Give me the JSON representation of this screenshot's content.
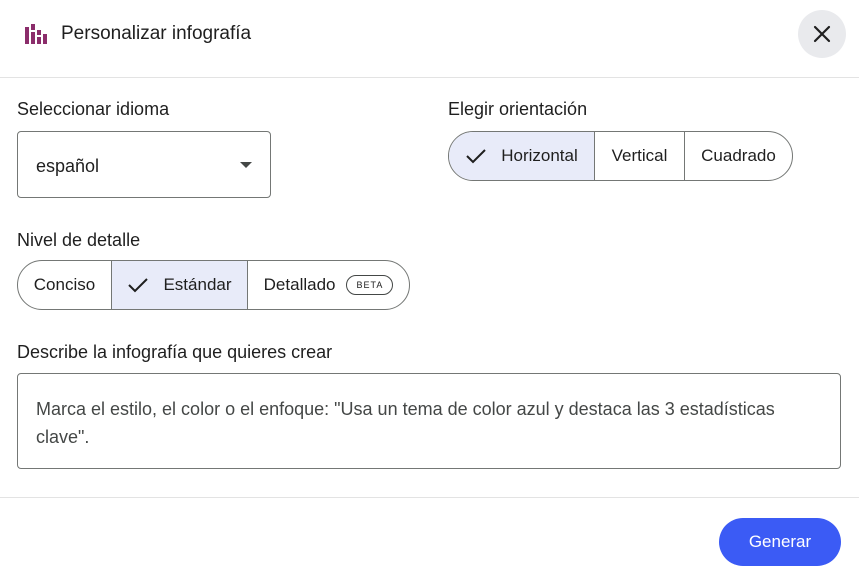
{
  "dialog": {
    "title": "Personalizar infografía",
    "title_icon": "infographic-icon",
    "close_icon": "close-icon"
  },
  "language": {
    "label": "Seleccionar idioma",
    "selected": "español",
    "caret_icon": "dropdown-caret-icon"
  },
  "orientation": {
    "label": "Elegir orientación",
    "options": [
      "Horizontal",
      "Vertical",
      "Cuadrado"
    ],
    "selected": "Horizontal"
  },
  "detail": {
    "label": "Nivel de detalle",
    "options": [
      "Conciso",
      "Estándar",
      "Detallado"
    ],
    "selected": "Estándar",
    "beta_badge": "BETA"
  },
  "description": {
    "label": "Describe la infografía que quieres crear",
    "placeholder": "Marca el estilo, el color o el enfoque: \"Usa un tema de color azul y destaca las 3 estadísticas clave\"."
  },
  "footer": {
    "generate_label": "Generar"
  },
  "colors": {
    "accent": "#3b5bf5",
    "selected_segment": "#e8ebf9",
    "icon_purple": "#8b2d6b"
  }
}
